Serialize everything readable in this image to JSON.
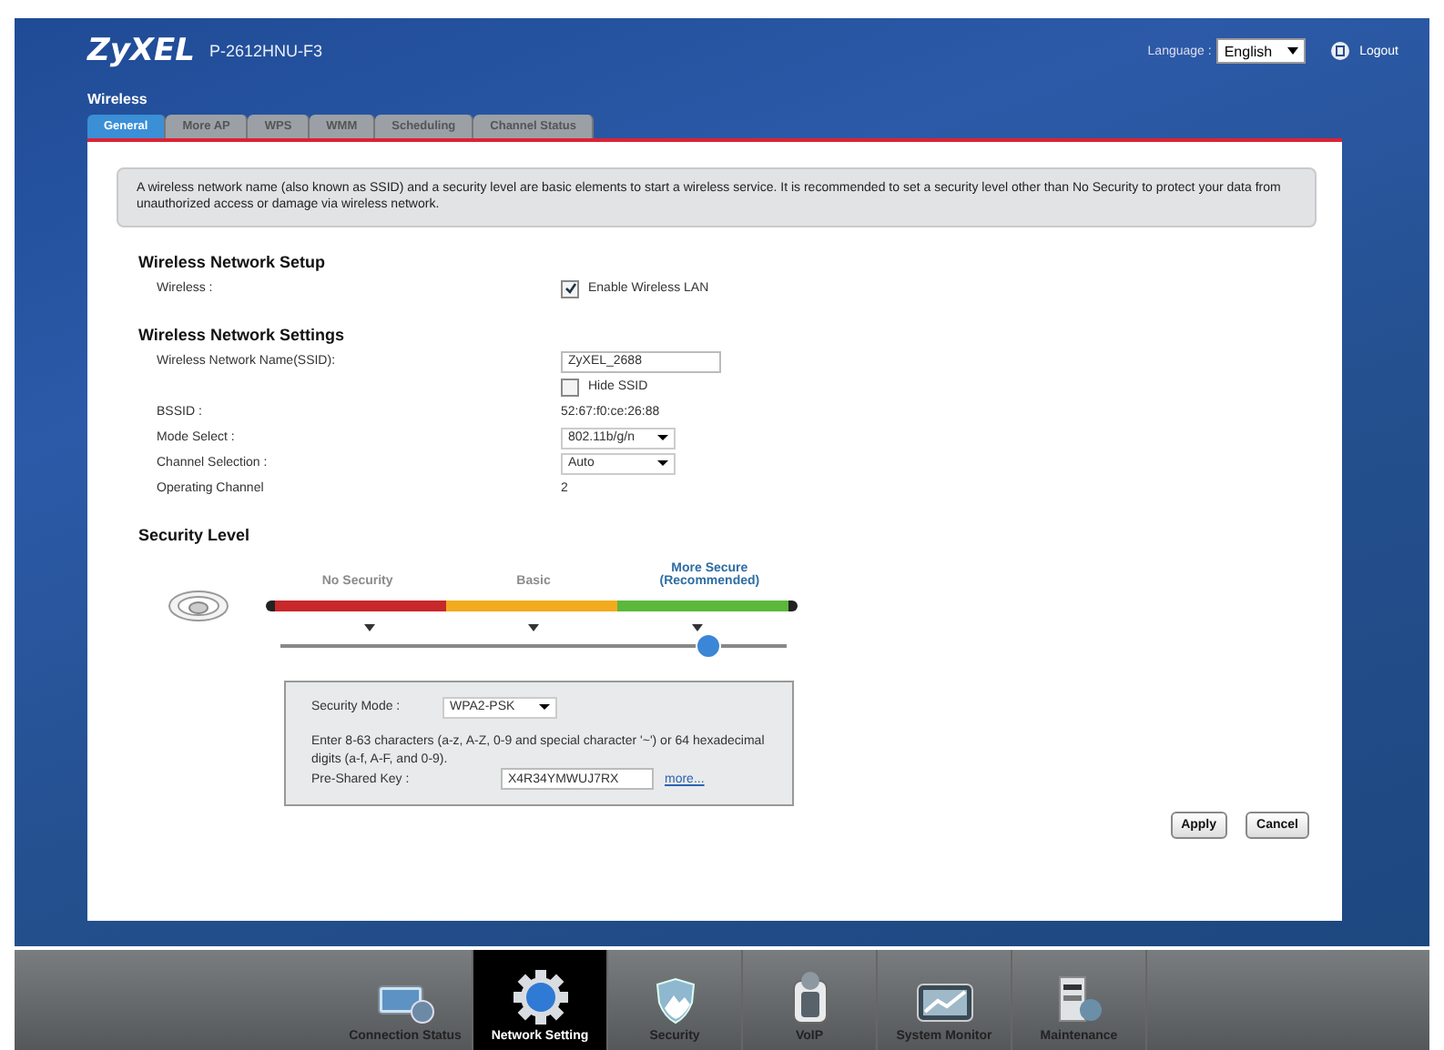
{
  "header": {
    "logo": "ZyXEL",
    "model": "P-2612HNU-F3",
    "language_label": "Language :",
    "language": "English",
    "logout": "Logout"
  },
  "page_title": "Wireless",
  "tabs": [
    {
      "label": "General",
      "selected": true
    },
    {
      "label": "More AP",
      "selected": false
    },
    {
      "label": "WPS",
      "selected": false
    },
    {
      "label": "WMM",
      "selected": false
    },
    {
      "label": "Scheduling",
      "selected": false
    },
    {
      "label": "Channel Status",
      "selected": false
    }
  ],
  "notice": "A wireless network name (also known as SSID) and a security level are basic elements to start a wireless service. It is recommended to set a security level other than No Security to protect your data from unauthorized access or damage via wireless network.",
  "sections": [
    {
      "title": "Wireless Network Setup",
      "rows": [
        {
          "kind": "checkbox",
          "label": "Wireless :",
          "text": "Enable Wireless LAN",
          "checked": true
        }
      ]
    },
    {
      "title": "Wireless Network Settings",
      "rows": [
        {
          "kind": "input",
          "label": "Wireless Network Name(SSID):",
          "value": "ZyXEL_2688"
        },
        {
          "kind": "checkbox",
          "text": "Hide SSID",
          "checked": false
        },
        {
          "kind": "value",
          "label": "BSSID :",
          "value": "52:67:f0:ce:26:88"
        },
        {
          "kind": "select",
          "label": "Mode Select :",
          "value": "802.11b/g/n"
        },
        {
          "kind": "select",
          "label": "Channel Selection :",
          "value": "Auto"
        },
        {
          "kind": "value",
          "label": "Operating Channel",
          "value": "2"
        }
      ]
    }
  ],
  "security": {
    "title": "Security Level",
    "levels": [
      {
        "label": "No Security",
        "selected": false,
        "color": "#c8282a"
      },
      {
        "label": "Basic",
        "selected": false,
        "color": "#f2ab1e"
      },
      {
        "label": "More Secure (Recommended)",
        "selected": true,
        "color": "#5cb83a"
      }
    ],
    "level": 0.84,
    "mode_label": "Security Mode :",
    "mode": "WPA2-PSK",
    "hint": "Enter 8-63 characters (a-z, A-Z, 0-9 and special character '~') or 64 hexadecimal digits (a-f, A-F, and 0-9).",
    "psk_label": "Pre-Shared Key :",
    "psk": "X4R34YMWUJ7RX",
    "more": "more..."
  },
  "buttons": [
    "Apply",
    "Cancel"
  ],
  "nav": [
    {
      "label": "Connection Status",
      "selected": false,
      "kind": "monitor"
    },
    {
      "label": "Network Setting",
      "selected": true,
      "kind": "gear"
    },
    {
      "label": "Security",
      "selected": false,
      "kind": "shield"
    },
    {
      "label": "VoIP",
      "selected": false,
      "kind": "phone"
    },
    {
      "label": "System Monitor",
      "selected": false,
      "kind": "chart"
    },
    {
      "label": "Maintenance",
      "selected": false,
      "kind": "tools"
    }
  ]
}
